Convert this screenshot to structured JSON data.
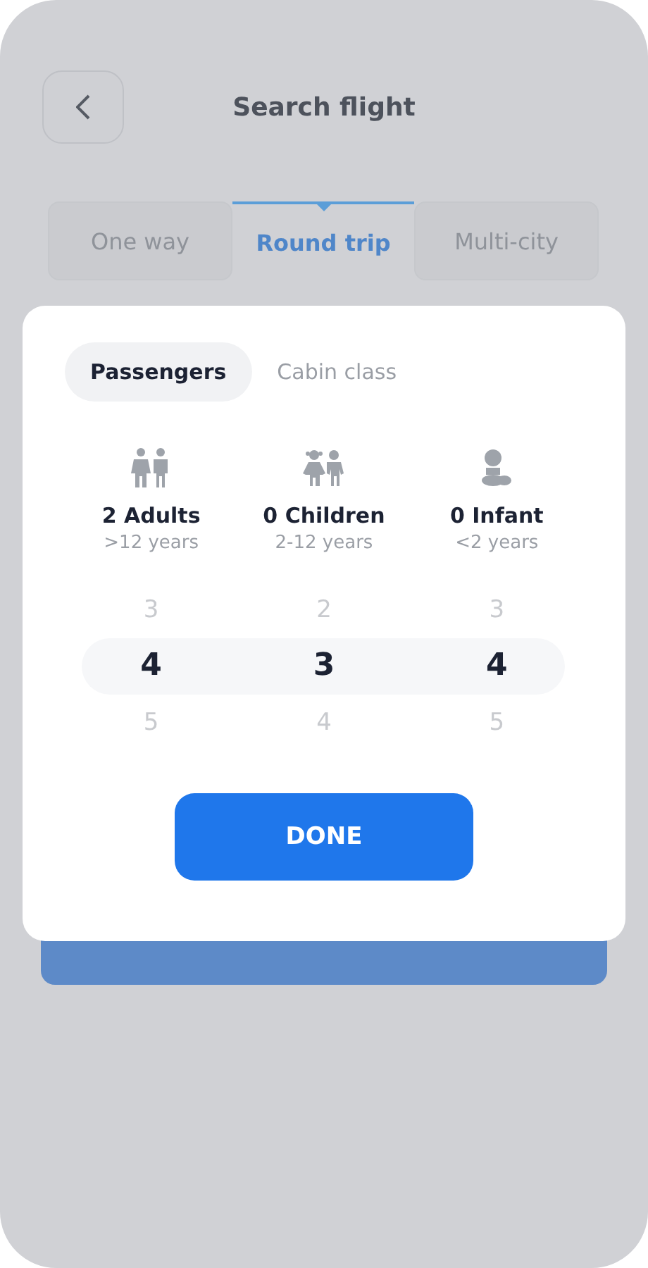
{
  "header": {
    "title": "Search flight"
  },
  "trip_tabs": [
    {
      "label": "One way",
      "selected": false
    },
    {
      "label": "Round trip",
      "selected": true
    },
    {
      "label": "Multi-city",
      "selected": false
    }
  ],
  "sheet": {
    "tabs": [
      {
        "label": "Passengers",
        "selected": true
      },
      {
        "label": "Cabin class",
        "selected": false
      }
    ],
    "categories": [
      {
        "kind": "adult",
        "label": "2 Adults",
        "ages": ">12 years",
        "wheel": [
          {
            "value": "3",
            "selected": false
          },
          {
            "value": "4",
            "selected": true
          },
          {
            "value": "5",
            "selected": false
          }
        ]
      },
      {
        "kind": "child",
        "label": "0 Children",
        "ages": "2-12 years",
        "wheel": [
          {
            "value": "2",
            "selected": false
          },
          {
            "value": "3",
            "selected": true
          },
          {
            "value": "4",
            "selected": false
          }
        ]
      },
      {
        "kind": "infant",
        "label": "0 Infant",
        "ages": "<2 years",
        "wheel": [
          {
            "value": "3",
            "selected": false
          },
          {
            "value": "4",
            "selected": true
          },
          {
            "value": "5",
            "selected": false
          }
        ]
      }
    ],
    "done_button": "DONE"
  }
}
